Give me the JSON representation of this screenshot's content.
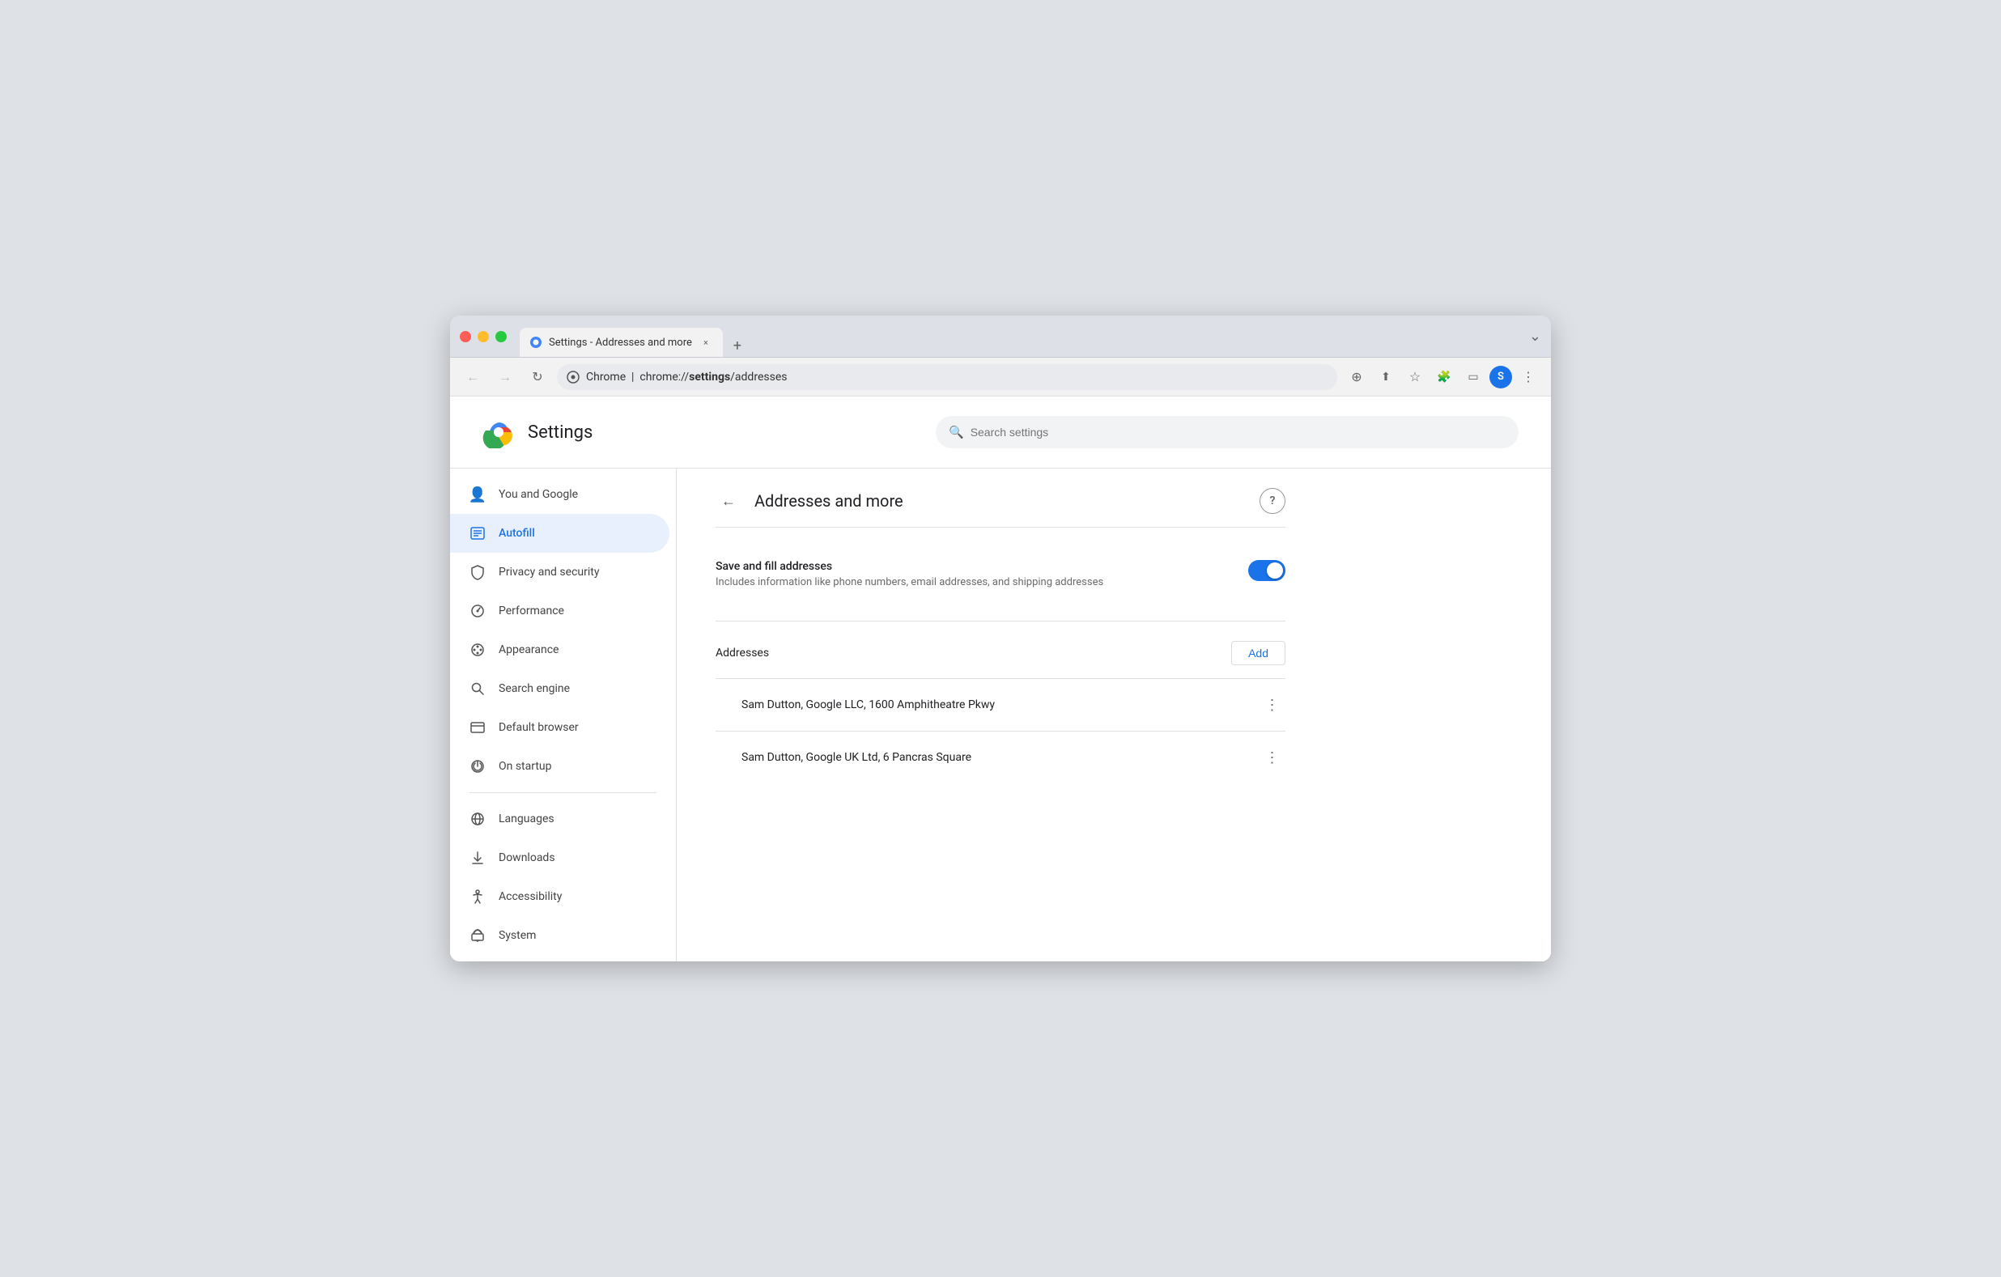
{
  "browser": {
    "tab_title": "Settings - Addresses and more",
    "tab_close_label": "×",
    "new_tab_label": "+",
    "window_menu_label": "⌄",
    "nav_back": "←",
    "nav_forward": "→",
    "nav_refresh": "↻",
    "address_bar_prefix": "Chrome  |  chrome://",
    "address_bar_bold": "settings",
    "address_bar_suffix": "/addresses",
    "toolbar_icons": {
      "zoom": "⊕",
      "share": "⬆",
      "star": "☆",
      "extensions": "⊞",
      "sidebar": "⬜",
      "menu": "⋮"
    },
    "profile_initial": "S"
  },
  "settings": {
    "title": "Settings",
    "search_placeholder": "Search settings"
  },
  "sidebar": {
    "items": [
      {
        "id": "you-and-google",
        "label": "You and Google",
        "icon": "👤"
      },
      {
        "id": "autofill",
        "label": "Autofill",
        "icon": "📋",
        "active": true
      },
      {
        "id": "privacy-security",
        "label": "Privacy and security",
        "icon": "🛡"
      },
      {
        "id": "performance",
        "label": "Performance",
        "icon": "⏱"
      },
      {
        "id": "appearance",
        "label": "Appearance",
        "icon": "🎨"
      },
      {
        "id": "search-engine",
        "label": "Search engine",
        "icon": "🔍"
      },
      {
        "id": "default-browser",
        "label": "Default browser",
        "icon": "⬛"
      },
      {
        "id": "on-startup",
        "label": "On startup",
        "icon": "⏻"
      }
    ],
    "items_section2": [
      {
        "id": "languages",
        "label": "Languages",
        "icon": "🌐"
      },
      {
        "id": "downloads",
        "label": "Downloads",
        "icon": "⬇"
      },
      {
        "id": "accessibility",
        "label": "Accessibility",
        "icon": "♿"
      },
      {
        "id": "system",
        "label": "System",
        "icon": "🔧"
      }
    ]
  },
  "content": {
    "back_label": "←",
    "title": "Addresses and more",
    "help_label": "?",
    "save_fill": {
      "label": "Save and fill addresses",
      "description": "Includes information like phone numbers, email addresses, and shipping addresses",
      "enabled": true
    },
    "addresses": {
      "section_label": "Addresses",
      "add_button": "Add",
      "items": [
        {
          "text": "Sam Dutton, Google LLC, 1600 Amphitheatre Pkwy"
        },
        {
          "text": "Sam Dutton, Google UK Ltd, 6 Pancras Square"
        }
      ],
      "more_button": "⋮"
    }
  }
}
